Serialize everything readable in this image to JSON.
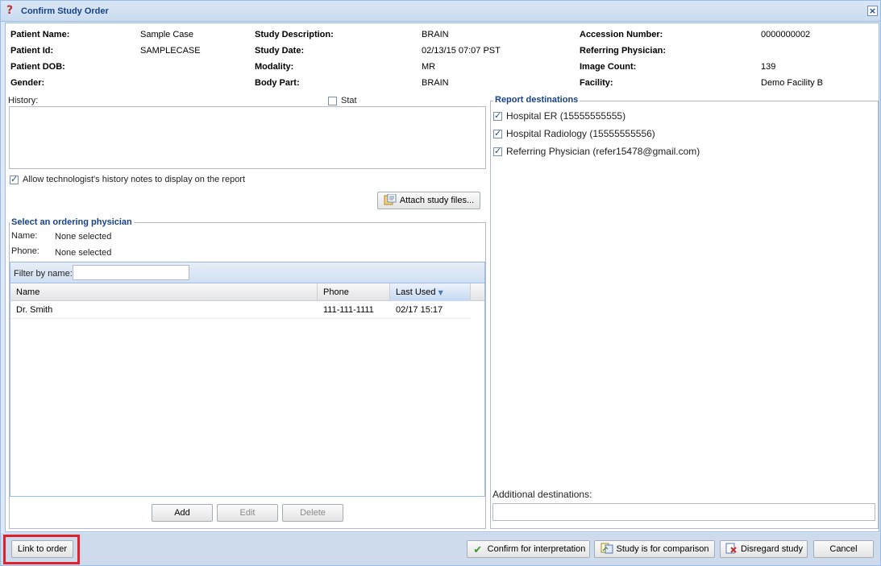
{
  "window": {
    "title": "Confirm Study Order",
    "title_icon": "question-icon",
    "close_icon": "close-icon"
  },
  "patient_info": {
    "name_label": "Patient Name:",
    "name_value": "Sample Case",
    "id_label": "Patient Id:",
    "id_value": "SAMPLECASE",
    "dob_label": "Patient DOB:",
    "dob_value": "",
    "gender_label": "Gender:",
    "gender_value": "",
    "study_desc_label": "Study Description:",
    "study_desc_value": "BRAIN",
    "study_date_label": "Study Date:",
    "study_date_value": "02/13/15 07:07 PST",
    "modality_label": "Modality:",
    "modality_value": "MR",
    "body_part_label": "Body Part:",
    "body_part_value": "BRAIN",
    "accession_label": "Accession Number:",
    "accession_value": "0000000002",
    "ref_phys_label": "Referring Physician:",
    "ref_phys_value": "",
    "image_count_label": "Image Count:",
    "image_count_value": "139",
    "facility_label": "Facility:",
    "facility_value": "Demo Facility B"
  },
  "history": {
    "label": "History:",
    "value": "",
    "stat_label": "Stat",
    "stat_checked": false,
    "allow_label": "Allow technologist's history notes to display on the report",
    "allow_checked": true,
    "attach_button": "Attach study files..."
  },
  "physician": {
    "legend": "Select an ordering physician",
    "name_label": "Name:",
    "name_value": "None selected",
    "phone_label": "Phone:",
    "phone_value": "None selected",
    "filter_label": "Filter by name:",
    "filter_value": "",
    "columns": [
      "Name",
      "Phone",
      "Last Used"
    ],
    "sorted_column": "Last Used",
    "rows": [
      {
        "name": "Dr. Smith",
        "phone": "111-111-1111",
        "last_used": "02/17 15:17"
      }
    ],
    "add_button": "Add",
    "edit_button": "Edit",
    "delete_button": "Delete"
  },
  "destinations": {
    "legend": "Report destinations",
    "items": [
      {
        "label": "Hospital ER (15555555555)",
        "checked": true
      },
      {
        "label": "Hospital Radiology (15555555556)",
        "checked": true
      },
      {
        "label": "Referring Physician (refer15478@gmail.com)",
        "checked": true
      }
    ],
    "additional_label": "Additional destinations:",
    "additional_value": ""
  },
  "footer": {
    "link_button": "Link to order",
    "confirm_button": "Confirm for interpretation",
    "comparison_button": "Study is for comparison",
    "disregard_button": "Disregard study",
    "cancel_button": "Cancel",
    "highlight_color": "#e0202a"
  },
  "colors": {
    "accent": "#15428b",
    "border": "#99bbe8",
    "background": "#dfe8f6"
  }
}
